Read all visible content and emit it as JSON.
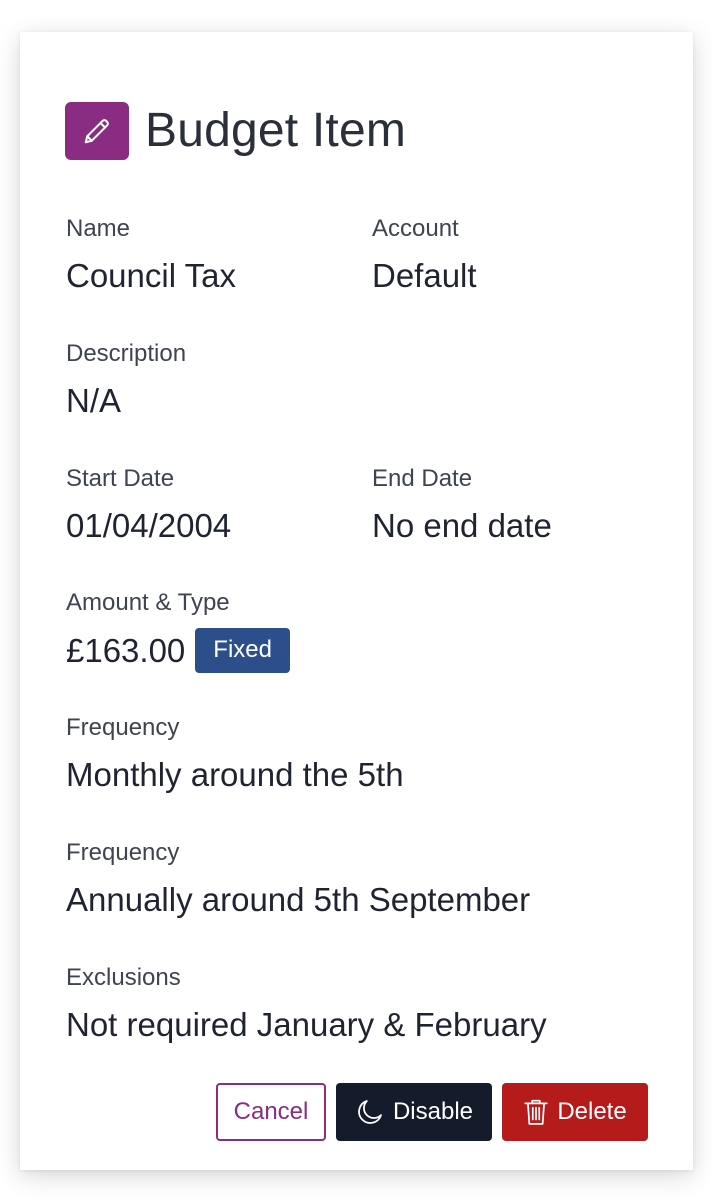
{
  "header": {
    "title": "Budget Item",
    "icon": "pencil-icon",
    "icon_bg": "#8b2c83"
  },
  "fields": {
    "name": {
      "label": "Name",
      "value": "Council Tax"
    },
    "account": {
      "label": "Account",
      "value": "Default"
    },
    "description": {
      "label": "Description",
      "value": "N/A"
    },
    "start_date": {
      "label": "Start Date",
      "value": "01/04/2004"
    },
    "end_date": {
      "label": "End Date",
      "value": "No end date"
    },
    "amount_type": {
      "label": "Amount & Type",
      "amount": "£163.00",
      "type_badge": "Fixed"
    },
    "frequency_1": {
      "label": "Frequency",
      "value": "Monthly around the 5th"
    },
    "frequency_2": {
      "label": "Frequency",
      "value": "Annually around 5th September"
    },
    "exclusions": {
      "label": "Exclusions",
      "value": "Not required January & February"
    }
  },
  "actions": {
    "cancel_label": "Cancel",
    "disable_label": "Disable",
    "disable_icon": "moon-icon",
    "delete_label": "Delete",
    "delete_icon": "trash-icon"
  },
  "colors": {
    "accent": "#8b2c83",
    "badge": "#2c4f8c",
    "disable": "#141c2c",
    "delete": "#b51b1b"
  }
}
